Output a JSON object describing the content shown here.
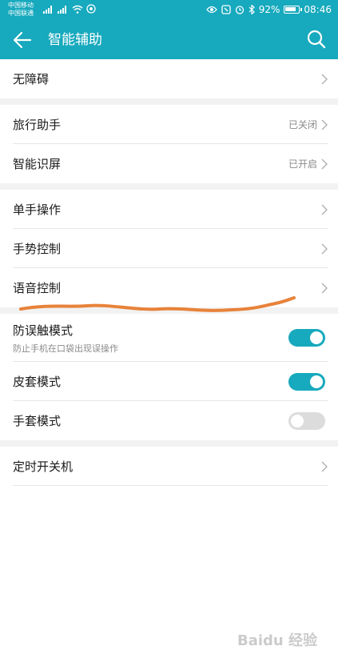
{
  "status_bar": {
    "carrier1": "中国移动",
    "carrier2": "中国联通",
    "battery_pct": "92%",
    "time": "08:46"
  },
  "app_bar": {
    "title": "智能辅助"
  },
  "groups": [
    [
      {
        "label": "无障碍",
        "value": ""
      }
    ],
    [
      {
        "label": "旅行助手",
        "value": "已关闭"
      },
      {
        "label": "智能识屏",
        "value": "已开启"
      }
    ],
    [
      {
        "label": "单手操作",
        "value": ""
      },
      {
        "label": "手势控制",
        "value": ""
      },
      {
        "label": "语音控制",
        "value": ""
      }
    ],
    [
      {
        "label": "防误触模式",
        "sub": "防止手机在口袋出现误操作",
        "toggle": true
      },
      {
        "label": "皮套模式",
        "toggle": true
      },
      {
        "label": "手套模式",
        "toggle": false
      }
    ],
    [
      {
        "label": "定时开关机",
        "value": ""
      }
    ]
  ],
  "watermark": "Baidu 经验",
  "colors": {
    "accent": "#17a9bd",
    "annotation": "#e8823a"
  }
}
